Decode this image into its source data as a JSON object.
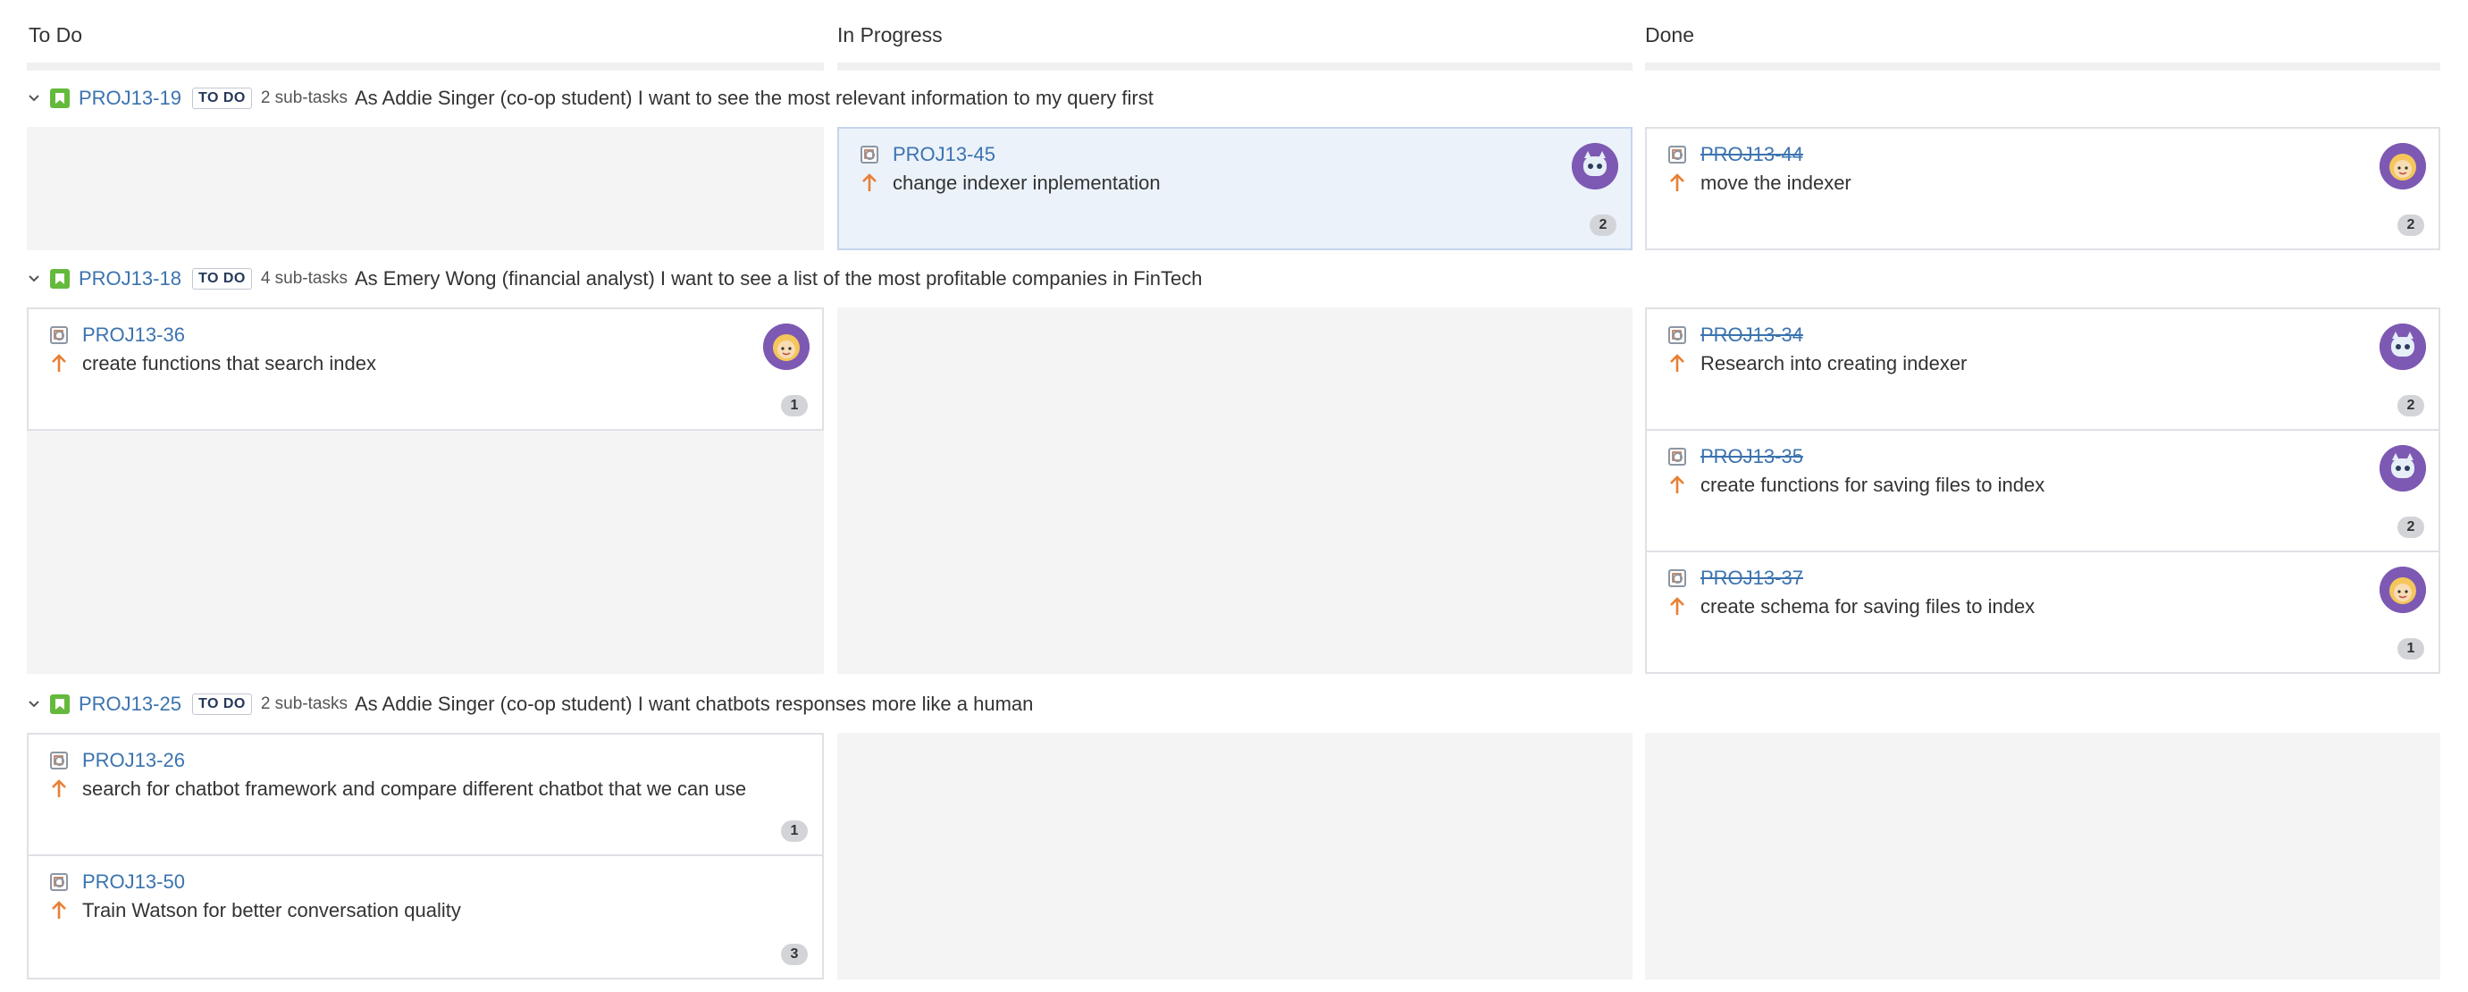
{
  "columns": [
    "To Do",
    "In Progress",
    "Done"
  ],
  "swimlanes": [
    {
      "key": "PROJ13-19",
      "status": "TO DO",
      "subtasks": "2 sub-tasks",
      "summary": "As Addie Singer (co-op student) I want to see the most relevant information to my query first",
      "in_progress": [
        {
          "key": "PROJ13-45",
          "summary": "change indexer inplementation",
          "estimate": "2",
          "avatar": "robot-avatar"
        }
      ],
      "done": [
        {
          "key": "PROJ13-44",
          "summary": "move the indexer",
          "estimate": "2",
          "avatar": "person-avatar"
        }
      ]
    },
    {
      "key": "PROJ13-18",
      "status": "TO DO",
      "subtasks": "4 sub-tasks",
      "summary": "As Emery Wong (financial analyst) I want to see a list of the most profitable companies in FinTech",
      "todo": [
        {
          "key": "PROJ13-36",
          "summary": "create functions that search index",
          "estimate": "1",
          "avatar": "person-avatar"
        }
      ],
      "done": [
        {
          "key": "PROJ13-34",
          "summary": "Research into creating indexer",
          "estimate": "2",
          "avatar": "robot-avatar"
        },
        {
          "key": "PROJ13-35",
          "summary": "create functions for saving files to index",
          "estimate": "2",
          "avatar": "robot-avatar"
        },
        {
          "key": "PROJ13-37",
          "summary": "create schema for saving files to index",
          "estimate": "1",
          "avatar": "person-avatar"
        }
      ]
    },
    {
      "key": "PROJ13-25",
      "status": "TO DO",
      "subtasks": "2 sub-tasks",
      "summary": "As Addie Singer (co-op student) I want chatbots responses more like a human",
      "todo": [
        {
          "key": "PROJ13-26",
          "summary": "search for chatbot framework and compare different chatbot that we can use",
          "estimate": "1"
        },
        {
          "key": "PROJ13-50",
          "summary": "Train Watson for better conversation quality",
          "estimate": "3"
        }
      ]
    }
  ],
  "colors": {
    "accent_link": "#3b73af",
    "story": "#63ba3c",
    "priority": "#e97f33",
    "avatar_bg": "#7d59b3"
  }
}
